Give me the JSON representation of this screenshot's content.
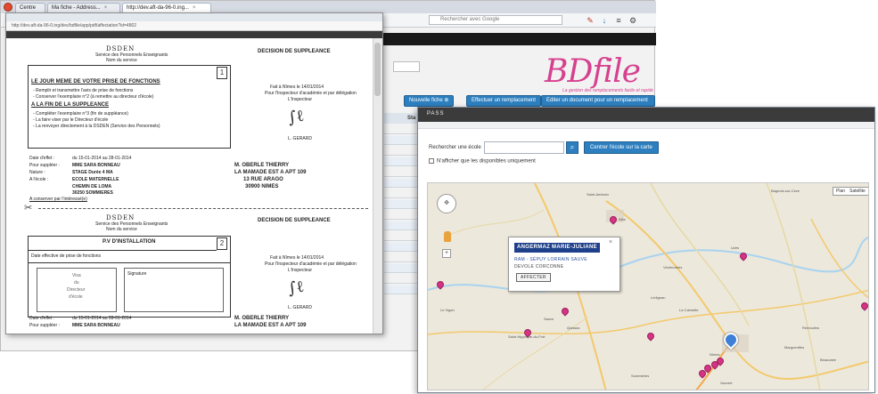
{
  "browser": {
    "tabs": [
      "Centre",
      "Ma fiche - Address...",
      "http://dev.aft-da-96-0.ing..."
    ],
    "search_placeholder": "Rechercher avec Google"
  },
  "background_app": {
    "logo": "BDfile",
    "logo_tagline": "La gestion des remplacements facile et rapide",
    "buttons": [
      "Nouvelle fiche",
      "Effectuer un remplacement",
      "Editer un document pour un remplacement"
    ],
    "table_header": "Sta",
    "table_rows": [
      "",
      "",
      "",
      "",
      "",
      "",
      "",
      "",
      "",
      "",
      "",
      "",
      "",
      "",
      "",
      ""
    ]
  },
  "pdf_window": {
    "url": "http://dev.aft-da-96-0.ing/dev/bdfile/app/pdf/affectation?id=4802",
    "upper": {
      "dsden": "DSDEN",
      "dsden_sub1": "Service des Personnels Enseignants",
      "dsden_sub2": "Nom du service",
      "decision_title": "DECISION DE SUPPLEANCE",
      "step_number": "1",
      "instruction_heading1": "LE JOUR MEME DE VOTRE PRISE DE FONCTIONS",
      "instruction_heading2": "A LA FIN DE LA SUPPLEANCE",
      "instruction_lines": [
        "- Remplir et transmettre l'avis de prise de fonctions",
        "- Conserver l'exemplaire n°2 (à remettre au directeur d'école)",
        "- Compléter l'exemplaire n°3 (fin de suppléance)",
        "- La faire viser par le Directeur d'école",
        "- La renvoyer directement à la DSDEN (Service des Personnels)"
      ],
      "date_place": "Fait à Nîmes le 14/01/2014",
      "signatory": "Pour l'Inspecteur d'académie et par délégation",
      "signatory_role": "L'Inspecteur",
      "signature_name": "L. GERARD",
      "assignment_date": "du 15-01-2014 au 28-01-2014",
      "fields": [
        {
          "label": "Date d'effet :",
          "value": "du 15-01-2014 au 28-01-2014"
        },
        {
          "label": "Pour suppléer :",
          "value": "MME SARA BONNEAU"
        },
        {
          "label": "Nature :",
          "value": "STAGE Durée 4 MA"
        },
        {
          "label": "A l'école :",
          "value": "ECOLE MATERNELLE"
        }
      ],
      "school_lines": [
        "CHEMIN DE LOMA",
        "30250 SOMMIERES"
      ],
      "recipient_name": "M. OBERLE THIERRY",
      "recipient_line2": "LA MAMADE EST A APT 109",
      "recipient_line3": "13 RUE ARAGO",
      "recipient_city": "30900 NIMES",
      "footer_note": "A conserver par l'intéressé(e)"
    },
    "lower": {
      "dsden": "DSDEN",
      "dsden_sub1": "Service des Personnels Enseignants",
      "dsden_sub2": "Nom du service",
      "decision_title": "DECISION DE SUPPLEANCE",
      "step_number": "2",
      "box_title": "P.V D'INSTALLATION",
      "box_sub": "Date effective de prise de fonctions",
      "stamp_lines": [
        "Visa",
        "du",
        "Directeur",
        "d'école"
      ],
      "signature_label": "Signature",
      "date_place": "Fait à Nîmes le 14/01/2014",
      "signatory": "Pour l'Inspecteur d'académie et par délégation",
      "signatory_role": "L'Inspecteur",
      "signature_name": "L. GERARD",
      "fields": [
        {
          "label": "Date d'effet :",
          "value": "du 15-01-2014 au 28-01-2014"
        },
        {
          "label": "Pour suppléer :",
          "value": "MME SARA BONNEAU"
        }
      ],
      "recipient_name": "M. OBERLE THIERRY",
      "recipient_line2": "LA MAMADE EST A APT 109"
    }
  },
  "map_panel": {
    "header": "PASS",
    "search_label": "Rechercher une école",
    "search_value": "",
    "center_button": "Centrer l'école sur la carte",
    "only_available_label": "N'afficher que les disponibles uniquement",
    "map_types": [
      "Plan",
      "Satellite"
    ],
    "infowindow": {
      "name": "ANGERMAZ MARIE-JULIANE",
      "line1": "RAM - SÉPUY LORRAIN SAUVE",
      "line2": "DEVOLE CORCONNE",
      "button": "AFFECTER"
    },
    "place_labels": [
      "Bagnols-sur-Cèze",
      "Saint-Ambroix",
      "Alès",
      "Uzès",
      "Saint-Hippolyte-du-Fort",
      "Quissac",
      "Sommières",
      "Nîmes",
      "Vauvert",
      "Le Vigan",
      "Sauve",
      "Lédignan",
      "Remoulins",
      "Beaucaire",
      "Anduze",
      "Saint-Jean-du-Gard",
      "Vézénobres",
      "La Calmette",
      "Marguerittes"
    ]
  },
  "colors": {
    "accent_blue": "#2d7fbf",
    "pin_magenta": "#d63384",
    "logo_pink": "#d6418f",
    "header_dark": "#3b3b3b"
  }
}
